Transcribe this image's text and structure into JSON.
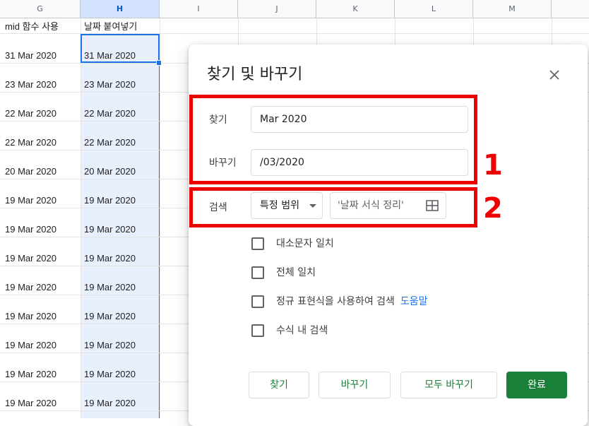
{
  "sheet": {
    "columns": [
      "G",
      "H",
      "I",
      "J",
      "K",
      "L",
      "M"
    ],
    "selected_column": "H",
    "headers": {
      "g": "mid 함수 사용",
      "h": "날짜 붙여넣기"
    },
    "rows": [
      {
        "g": "31 Mar 2020",
        "h": "31 Mar 2020"
      },
      {
        "g": "23 Mar 2020",
        "h": "23 Mar 2020"
      },
      {
        "g": "22 Mar 2020",
        "h": "22 Mar 2020"
      },
      {
        "g": "22 Mar 2020",
        "h": "22 Mar 2020"
      },
      {
        "g": "20 Mar 2020",
        "h": "20 Mar 2020"
      },
      {
        "g": "19 Mar 2020",
        "h": "19 Mar 2020"
      },
      {
        "g": "19 Mar 2020",
        "h": "19 Mar 2020"
      },
      {
        "g": "19 Mar 2020",
        "h": "19 Mar 2020"
      },
      {
        "g": "19 Mar 2020",
        "h": "19 Mar 2020"
      },
      {
        "g": "19 Mar 2020",
        "h": "19 Mar 2020"
      },
      {
        "g": "19 Mar 2020",
        "h": "19 Mar 2020"
      },
      {
        "g": "19 Mar 2020",
        "h": "19 Mar 2020"
      },
      {
        "g": "19 Mar 2020",
        "h": "19 Mar 2020"
      }
    ]
  },
  "dialog": {
    "title": "찾기 및 바꾸기",
    "find_label": "찾기",
    "find_value": "Mar 2020",
    "replace_label": "바꾸기",
    "replace_value": "/03/2020",
    "search_label": "검색",
    "search_scope": "특정 범위",
    "range_value": "'날짜 서식 정리'",
    "options": {
      "match_case": "대소문자 일치",
      "match_entire": "전체 일치",
      "regex": "정규 표현식을 사용하여 검색",
      "help": "도움말",
      "formulas": "수식 내 검색"
    },
    "buttons": {
      "find": "찾기",
      "replace": "바꾸기",
      "replace_all": "모두 바꾸기",
      "done": "완료"
    },
    "icons": {
      "close": "close-icon",
      "range": "grid-range-icon"
    }
  },
  "annotations": {
    "label_1": "1",
    "label_2": "2",
    "color": "#ee0000"
  },
  "colors": {
    "accent": "#1a73e8",
    "primary_button": "#188038"
  }
}
